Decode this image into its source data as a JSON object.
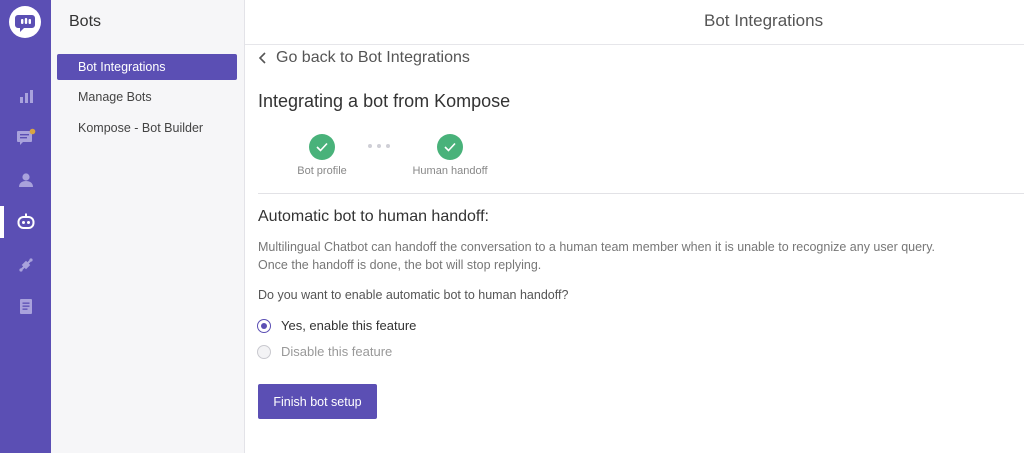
{
  "header": {
    "title": "Bot Integrations"
  },
  "rail": {
    "logo_icon": "chat-logo-icon",
    "items": [
      {
        "icon": "analytics-icon",
        "active": false
      },
      {
        "icon": "conversations-icon",
        "active": false
      },
      {
        "icon": "users-icon",
        "active": false
      },
      {
        "icon": "bot-icon",
        "active": true
      },
      {
        "icon": "integrations-icon",
        "active": false
      },
      {
        "icon": "reports-icon",
        "active": false
      }
    ]
  },
  "sidebar": {
    "title": "Bots",
    "items": [
      {
        "label": "Bot Integrations",
        "active": true
      },
      {
        "label": "Manage Bots",
        "active": false
      },
      {
        "label": "Kompose - Bot Builder",
        "active": false
      }
    ]
  },
  "main": {
    "back_label": "Go back to Bot Integrations",
    "heading": "Integrating a bot from Kompose",
    "steps": [
      {
        "label": "Bot profile",
        "done": true
      },
      {
        "label": "Human handoff",
        "done": true
      }
    ],
    "section_title": "Automatic bot to human handoff:",
    "description_line1": "Multilingual Chatbot can handoff the conversation to a human team member when it is unable to recognize any user query.",
    "description_line2": "Once the handoff is done, the bot will stop replying.",
    "question": "Do you want to enable automatic bot to human handoff?",
    "options": [
      {
        "label": "Yes, enable this feature",
        "selected": true
      },
      {
        "label": "Disable this feature",
        "selected": false
      }
    ],
    "finish_button": "Finish bot setup"
  },
  "colors": {
    "brand": "#5b4fb4",
    "success": "#49b27a",
    "sidebar_bg": "#f6f6f8"
  }
}
